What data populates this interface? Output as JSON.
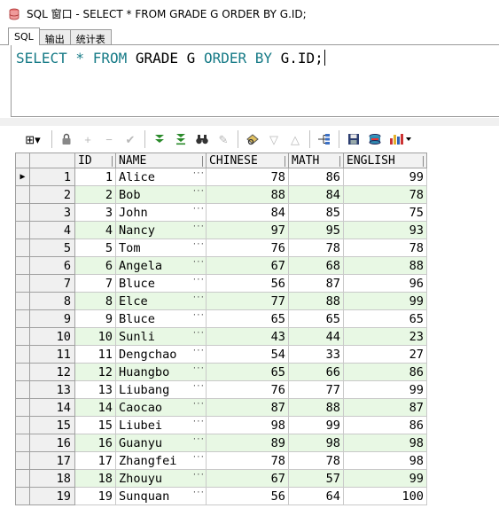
{
  "window": {
    "title": "SQL 窗口 - SELECT * FROM GRADE G ORDER BY G.ID;",
    "icon": "sql-window-icon"
  },
  "tabs": [
    {
      "label": "SQL",
      "active": true
    },
    {
      "label": "输出",
      "active": false
    },
    {
      "label": "统计表",
      "active": false
    }
  ],
  "editor": {
    "tokens": [
      {
        "text": "SELECT",
        "kind": "keyword"
      },
      {
        "text": " * ",
        "kind": "keyword"
      },
      {
        "text": "FROM",
        "kind": "keyword"
      },
      {
        "text": " GRADE G ",
        "kind": "identifier"
      },
      {
        "text": "ORDER",
        "kind": "keyword"
      },
      {
        "text": " ",
        "kind": "identifier"
      },
      {
        "text": "BY",
        "kind": "keyword"
      },
      {
        "text": " G.ID;",
        "kind": "identifier"
      }
    ],
    "keyword_color": "#177b87"
  },
  "toolbar": {
    "icons": [
      {
        "name": "grid-menu-icon",
        "glyph": "⊞▾",
        "enabled": true
      },
      {
        "name": "lock-icon",
        "glyph": "🔒",
        "enabled": true
      },
      {
        "name": "add-record-icon",
        "glyph": "+",
        "enabled": false
      },
      {
        "name": "delete-record-icon",
        "glyph": "−",
        "enabled": false
      },
      {
        "name": "post-changes-icon",
        "glyph": "✔",
        "enabled": false
      },
      {
        "name": "fetch-next-icon",
        "glyph": "⇓",
        "enabled": true
      },
      {
        "name": "fetch-last-icon",
        "glyph": "⤓",
        "enabled": true
      },
      {
        "name": "find-icon",
        "glyph": "🔍",
        "enabled": true
      },
      {
        "name": "clear-icon",
        "glyph": "✎",
        "enabled": false
      },
      {
        "name": "query-by-example-icon",
        "glyph": "⌂",
        "enabled": true
      },
      {
        "name": "previous-record-icon",
        "glyph": "▽",
        "enabled": false
      },
      {
        "name": "next-record-icon",
        "glyph": "△",
        "enabled": false
      },
      {
        "name": "export-icon",
        "glyph": "⋲",
        "enabled": true
      },
      {
        "name": "save-icon",
        "glyph": "💾",
        "enabled": true
      },
      {
        "name": "print-icon",
        "glyph": "⛁",
        "enabled": true
      },
      {
        "name": "chart-icon",
        "glyph": "📊▾",
        "enabled": true
      }
    ]
  },
  "grid": {
    "columns": [
      "ID",
      "NAME",
      "CHINESE",
      "MATH",
      "ENGLISH"
    ],
    "rows": [
      {
        "rownum": "1",
        "id": "1",
        "name": "Alice",
        "chinese": "78",
        "math": "86",
        "english": "99"
      },
      {
        "rownum": "2",
        "id": "2",
        "name": "Bob",
        "chinese": "88",
        "math": "84",
        "english": "78"
      },
      {
        "rownum": "3",
        "id": "3",
        "name": "John",
        "chinese": "84",
        "math": "85",
        "english": "75"
      },
      {
        "rownum": "4",
        "id": "4",
        "name": "Nancy",
        "chinese": "97",
        "math": "95",
        "english": "93"
      },
      {
        "rownum": "5",
        "id": "5",
        "name": "Tom",
        "chinese": "76",
        "math": "78",
        "english": "78"
      },
      {
        "rownum": "6",
        "id": "6",
        "name": "Angela",
        "chinese": "67",
        "math": "68",
        "english": "88"
      },
      {
        "rownum": "7",
        "id": "7",
        "name": "Bluce",
        "chinese": "56",
        "math": "87",
        "english": "96"
      },
      {
        "rownum": "8",
        "id": "8",
        "name": "Elce",
        "chinese": "77",
        "math": "88",
        "english": "99"
      },
      {
        "rownum": "9",
        "id": "9",
        "name": "Bluce",
        "chinese": "65",
        "math": "65",
        "english": "65"
      },
      {
        "rownum": "10",
        "id": "10",
        "name": "Sunli",
        "chinese": "43",
        "math": "44",
        "english": "23"
      },
      {
        "rownum": "11",
        "id": "11",
        "name": "Dengchao",
        "chinese": "54",
        "math": "33",
        "english": "27"
      },
      {
        "rownum": "12",
        "id": "12",
        "name": "Huangbo",
        "chinese": "65",
        "math": "66",
        "english": "86"
      },
      {
        "rownum": "13",
        "id": "13",
        "name": "Liubang",
        "chinese": "76",
        "math": "77",
        "english": "99"
      },
      {
        "rownum": "14",
        "id": "14",
        "name": "Caocao",
        "chinese": "87",
        "math": "88",
        "english": "87"
      },
      {
        "rownum": "15",
        "id": "15",
        "name": "Liubei",
        "chinese": "98",
        "math": "99",
        "english": "86"
      },
      {
        "rownum": "16",
        "id": "16",
        "name": "Guanyu",
        "chinese": "89",
        "math": "98",
        "english": "98"
      },
      {
        "rownum": "17",
        "id": "17",
        "name": "Zhangfei",
        "chinese": "78",
        "math": "78",
        "english": "98"
      },
      {
        "rownum": "18",
        "id": "18",
        "name": "Zhouyu",
        "chinese": "67",
        "math": "57",
        "english": "99"
      },
      {
        "rownum": "19",
        "id": "19",
        "name": "Sunquan",
        "chinese": "56",
        "math": "64",
        "english": "100"
      }
    ],
    "current_row": 1,
    "alt_row_color": "#e8f8e4"
  }
}
